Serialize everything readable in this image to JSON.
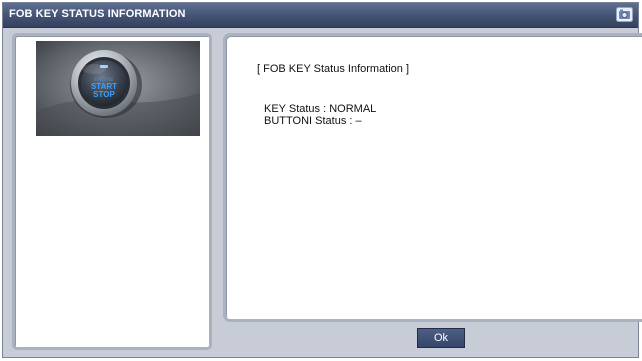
{
  "window": {
    "title": "FOB KEY STATUS INFORMATION",
    "title_icon": "camera-icon"
  },
  "image": {
    "button_text_line1": "START",
    "button_text_line2": "STOP",
    "icon": "start-stop-button-image"
  },
  "info": {
    "heading": "[ FOB KEY Status Information ]",
    "key_status": "KEY Status : NORMAL",
    "button_status": "BUTTONI Status : –"
  },
  "buttons": {
    "ok_label": "Ok"
  },
  "colors": {
    "titlebar": "#435374",
    "frame": "#c7ccd6",
    "panel": "#ffffff",
    "accent_blue": "#3aa0ff"
  }
}
